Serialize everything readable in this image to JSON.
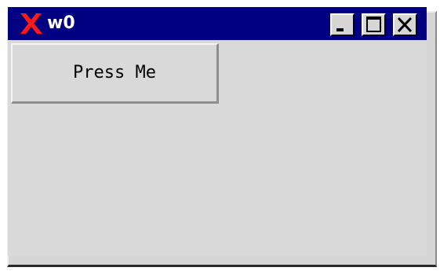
{
  "window": {
    "title": "w0",
    "titlebar_color": "#000080",
    "logo_icon": "x-logo-icon",
    "controls": {
      "minimize_icon": "minimize-icon",
      "maximize_icon": "maximize-icon",
      "close_icon": "close-icon"
    }
  },
  "client": {
    "button_label": "Press Me"
  }
}
